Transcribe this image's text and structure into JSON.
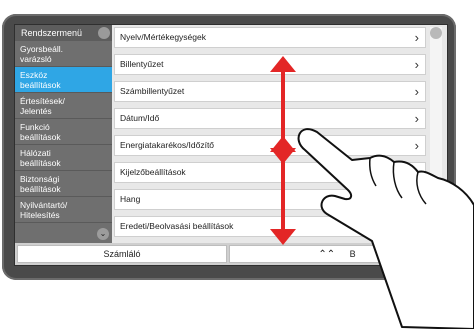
{
  "sidebar": {
    "header": "Rendszermenü",
    "items": [
      {
        "label_line1": "Gyorsbeáll.",
        "label_line2": "varázsló",
        "active": false
      },
      {
        "label_line1": "Eszköz",
        "label_line2": "beállítások",
        "active": true
      },
      {
        "label_line1": "Értesítések/",
        "label_line2": "Jelentés",
        "active": false
      },
      {
        "label_line1": "Funkció",
        "label_line2": "beállítások",
        "active": false
      },
      {
        "label_line1": "Hálózati",
        "label_line2": "beállítások",
        "active": false
      },
      {
        "label_line1": "Biztonsági",
        "label_line2": "beállítások",
        "active": false
      },
      {
        "label_line1": "Nyilvántartó/",
        "label_line2": "Hitelesítés",
        "active": false
      }
    ]
  },
  "list": {
    "items": [
      {
        "label": "Nyelv/Mértékegységek",
        "has_chevron": true
      },
      {
        "label": "Billentyűzet",
        "has_chevron": true
      },
      {
        "label": "Számbillentyűzet",
        "has_chevron": true
      },
      {
        "label": "Dátum/Idő",
        "has_chevron": true
      },
      {
        "label": "Energiatakarékos/Időzítő",
        "has_chevron": true
      },
      {
        "label": "Kijelzőbeállítások",
        "has_chevron": false
      },
      {
        "label": "Hang",
        "has_chevron": false
      },
      {
        "label": "Eredeti/Beolvasási beállítások",
        "has_chevron": false
      }
    ]
  },
  "bottom": {
    "counter_label": "Számláló",
    "right_label_partial": "B"
  },
  "colors": {
    "active_blue": "#2fa6e5",
    "arrow_red": "#e32626"
  }
}
